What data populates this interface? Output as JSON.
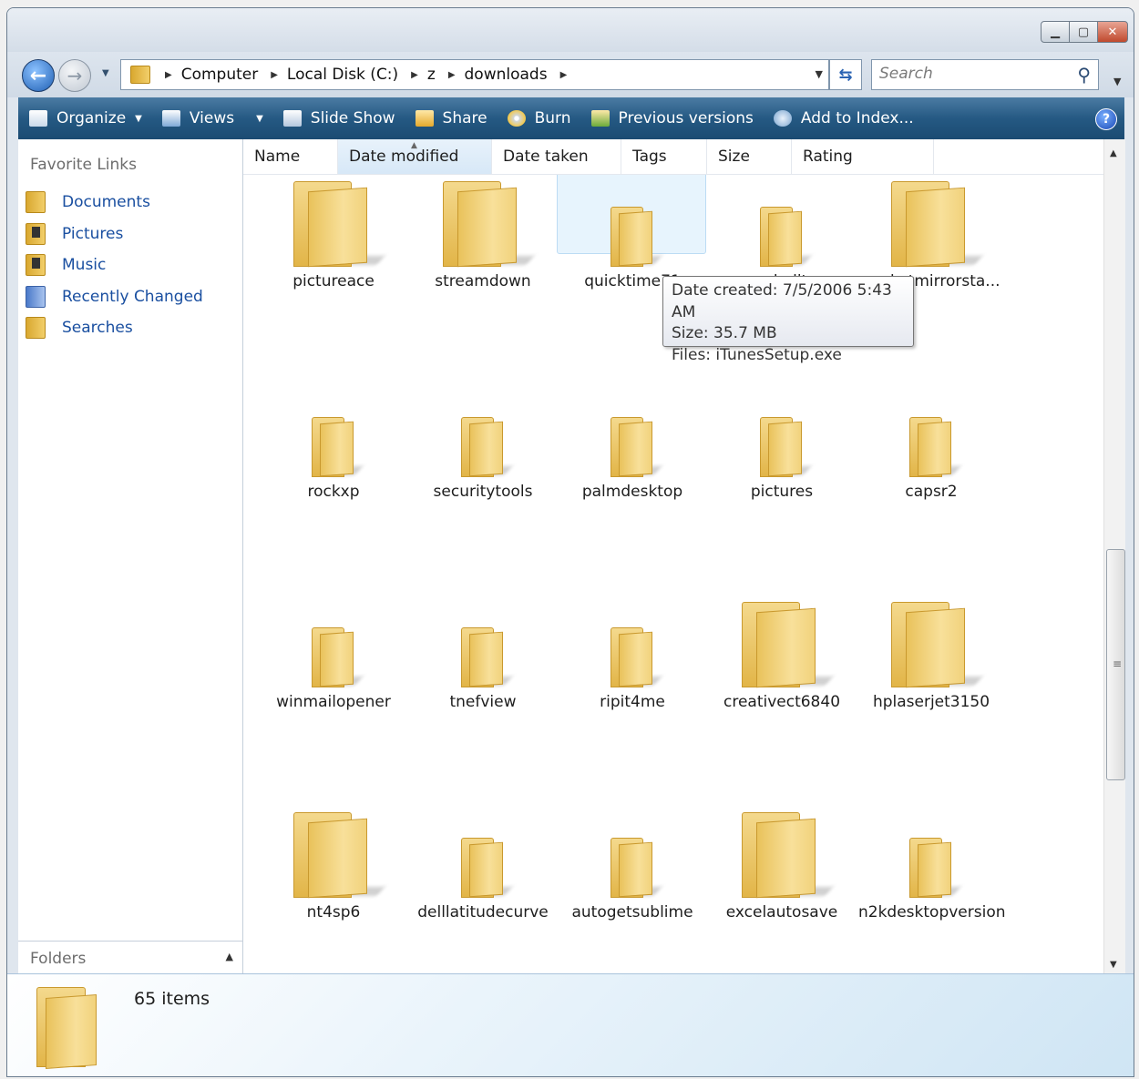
{
  "address": {
    "crumbs": [
      "Computer",
      "Local Disk (C:)",
      "z",
      "downloads"
    ],
    "search_placeholder": "Search"
  },
  "toolbar": {
    "items": [
      {
        "label": "Organize",
        "icon": "organize-icon",
        "dropdown": true
      },
      {
        "label": "Views",
        "icon": "views-icon",
        "dropdown": true
      },
      {
        "label": "Slide Show",
        "icon": "slideshow-icon",
        "dropdown": false
      },
      {
        "label": "Share",
        "icon": "share-icon",
        "dropdown": false
      },
      {
        "label": "Burn",
        "icon": "burn-icon",
        "dropdown": false
      },
      {
        "label": "Previous versions",
        "icon": "previous-versions-icon",
        "dropdown": false
      },
      {
        "label": "Add to Index...",
        "icon": "add-to-index-icon",
        "dropdown": false
      }
    ],
    "help": "?"
  },
  "nav": {
    "title": "Favorite Links",
    "items": [
      {
        "label": "Documents",
        "icon": "documents-icon"
      },
      {
        "label": "Pictures",
        "icon": "pictures-icon"
      },
      {
        "label": "Music",
        "icon": "music-icon"
      },
      {
        "label": "Recently Changed",
        "icon": "recently-changed-icon"
      },
      {
        "label": "Searches",
        "icon": "searches-icon"
      }
    ],
    "folders_label": "Folders"
  },
  "columns": [
    "Name",
    "Date modified",
    "Date taken",
    "Tags",
    "Size",
    "Rating"
  ],
  "sorted_column": "Date modified",
  "items": [
    {
      "name": "pictureace"
    },
    {
      "name": "streamdown"
    },
    {
      "name": "quicktime71",
      "selected": true
    },
    {
      "name": "soundeditpro"
    },
    {
      "name": "pocketmirrorsta..."
    },
    {
      "name": "rockxp"
    },
    {
      "name": "securitytools"
    },
    {
      "name": "palmdesktop"
    },
    {
      "name": "pictures"
    },
    {
      "name": "capsr2"
    },
    {
      "name": "winmailopener"
    },
    {
      "name": "tnefview"
    },
    {
      "name": "ripit4me"
    },
    {
      "name": "creativect6840"
    },
    {
      "name": "hplaserjet3150"
    },
    {
      "name": "nt4sp6"
    },
    {
      "name": "delllatitudecurve"
    },
    {
      "name": "autogetsublime"
    },
    {
      "name": "excelautosave"
    },
    {
      "name": "n2kdesktopversion"
    }
  ],
  "tooltip": {
    "line1": "Date created: 7/5/2006 5:43 AM",
    "line2": "Size: 35.7 MB",
    "line3": "Files: iTunesSetup.exe"
  },
  "status": {
    "count": "65 items"
  }
}
